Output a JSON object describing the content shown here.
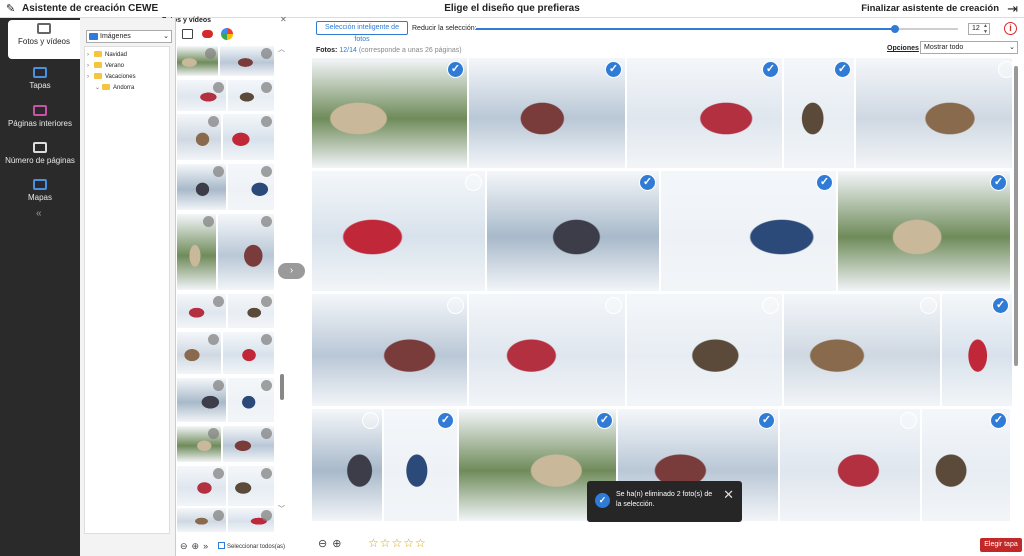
{
  "app": {
    "title": "Asistente de creación CEWE",
    "center_title": "Elige el diseño que prefieras",
    "finish": "Finalizar asistente de creación"
  },
  "nav": {
    "items": [
      {
        "label": "Fotos y vídeos",
        "icon": "photos-icon",
        "active": true
      },
      {
        "label": "Tapas",
        "icon": "cover-icon",
        "active": false
      },
      {
        "label": "Páginas interiores",
        "icon": "pages-icon",
        "active": false
      },
      {
        "label": "Número de páginas",
        "icon": "page-count-icon",
        "active": false
      },
      {
        "label": "Mapas",
        "icon": "map-icon",
        "active": false
      }
    ],
    "collapse": "«"
  },
  "files": {
    "title": "Fotos y vídeos",
    "folder": "Imágenes",
    "tree": [
      {
        "label": "Navidad",
        "level": 1,
        "expanded": false
      },
      {
        "label": "Verano",
        "level": 1,
        "expanded": false
      },
      {
        "label": "Vacaciones",
        "level": 1,
        "expanded": false
      },
      {
        "label": "Andorra",
        "level": 2,
        "expanded": true
      }
    ],
    "select_all": "Seleccionar todos(as)"
  },
  "toolbar": {
    "smart_selection": "Selección inteligente de fotos",
    "reduce_label": "Reducir la selección:",
    "slider_value": 0.87,
    "count": "12",
    "info": "i"
  },
  "photos": {
    "label": "Fotos:",
    "selected": "12/14",
    "note": "(corresponde a unas 26 páginas)",
    "options": "Opciones",
    "filter": "Mostrar todo"
  },
  "toast": {
    "message": "Se ha(n) eliminado 2 foto(s) de la selección."
  },
  "bottom": {
    "stars": "☆☆☆☆☆",
    "cover_button": "Elegir tapa"
  },
  "colors": {
    "accent": "#2f7bd6",
    "sidebar": "#2a2a2a",
    "danger": "#c32828"
  }
}
